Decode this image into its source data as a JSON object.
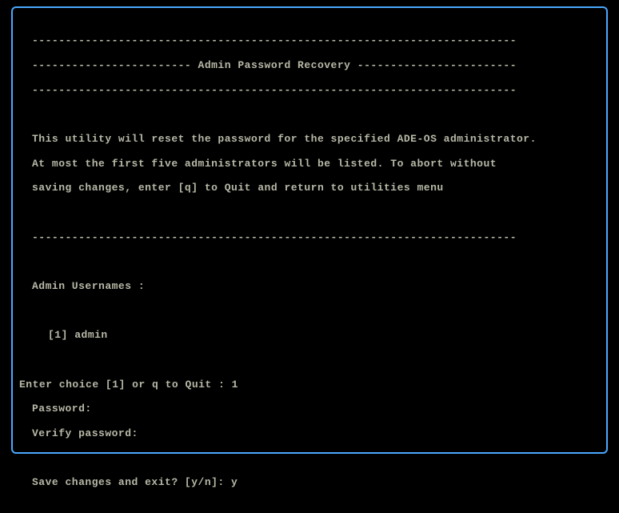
{
  "header": {
    "divider_top": "-------------------------------------------------------------------------",
    "title_line": "------------------------ Admin Password Recovery ------------------------",
    "divider_bot": "-------------------------------------------------------------------------"
  },
  "description": {
    "line1": "This utility will reset the password for the specified ADE-OS administrator.",
    "line2": "At most the first five administrators will be listed. To abort without",
    "line3": "saving changes, enter [q] to Quit and return to utilities menu"
  },
  "divider_mid": "-------------------------------------------------------------------------",
  "usernames": {
    "label": "Admin Usernames :",
    "items": [
      {
        "index": "[1]",
        "name": "admin"
      }
    ]
  },
  "prompts": {
    "choice_label": "Enter choice [1] or q to Quit : ",
    "choice_value": "1",
    "password_label": "Password:",
    "verify_label": "Verify password:",
    "save_label": "Save changes and exit? [y/n]: ",
    "save_value": "y"
  }
}
